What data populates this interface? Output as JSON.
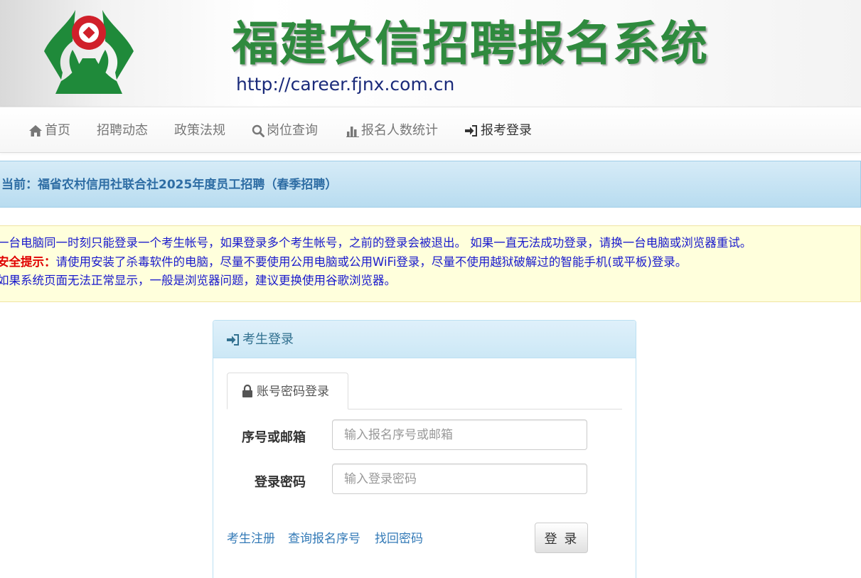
{
  "header": {
    "title": "福建农信招聘报名系统",
    "url": "http://career.fjnx.com.cn",
    "logo_colors": {
      "green": "#1f8a3a",
      "red": "#d0202a"
    }
  },
  "nav": {
    "items": [
      {
        "label": "首页",
        "icon": "home-icon"
      },
      {
        "label": "招聘动态"
      },
      {
        "label": "政策法规"
      },
      {
        "label": "岗位查询",
        "icon": "search-icon"
      },
      {
        "label": "报名人数统计",
        "icon": "bar-chart-icon"
      },
      {
        "label": "报考登录",
        "icon": "login-icon",
        "active": true
      }
    ]
  },
  "current": {
    "text": "当前：福省农村信用社联合社2025年度员工招聘（春季招聘）"
  },
  "notice": {
    "line1": "一台电脑同一时刻只能登录一个考生帐号，如果登录多个考生帐号，之前的登录会被退出。 如果一直无法成功登录，请换一台电脑或浏览器重试。",
    "line2_label": "安全提示：",
    "line2_text": "请使用安装了杀毒软件的电脑，尽量不要使用公用电脑或公用WiFi登录，尽量不使用越狱破解过的智能手机(或平板)登录。",
    "line3": "如果系统页面无法正常显示，一般是浏览器问题，建议更换使用谷歌浏览器。"
  },
  "login": {
    "panel_title": "考生登录",
    "tab_label": "账号密码登录",
    "account_label": "序号或邮箱",
    "account_placeholder": "输入报名序号或邮箱",
    "password_label": "登录密码",
    "password_placeholder": "输入登录密码",
    "links": {
      "register": "考生注册",
      "query_serial": "查询报名序号",
      "recover_password": "找回密码"
    },
    "submit_label": "登 录"
  }
}
